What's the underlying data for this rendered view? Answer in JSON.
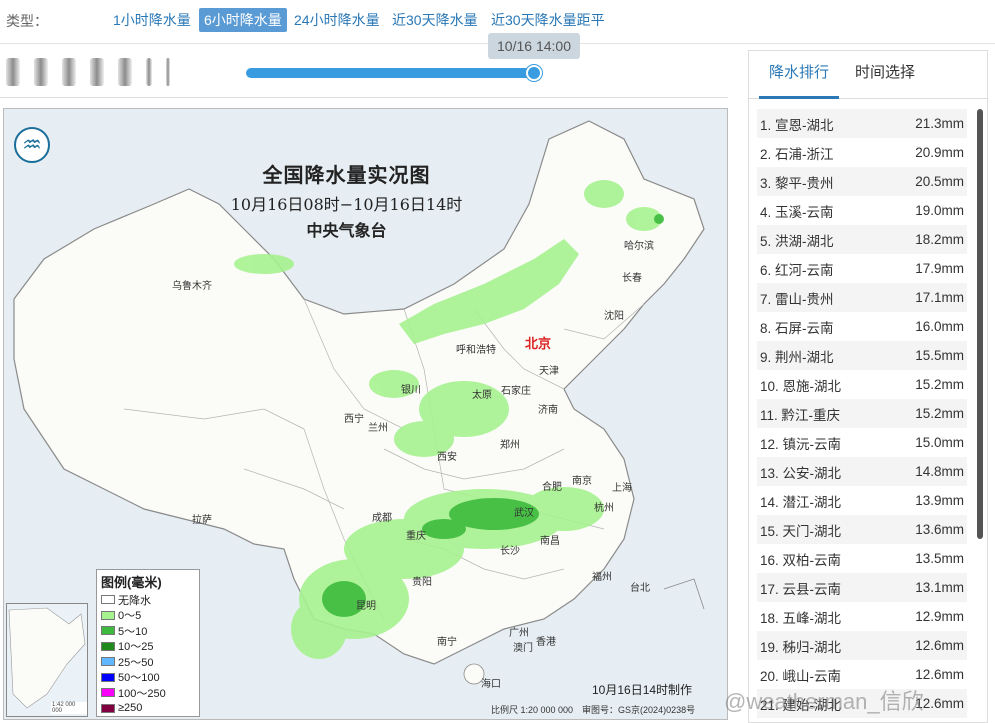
{
  "type_bar": {
    "label": "类型：",
    "tabs": [
      {
        "label": "1小时降水量",
        "active": false
      },
      {
        "label": "6小时降水量",
        "active": true
      },
      {
        "label": "24小时降水量",
        "active": false
      },
      {
        "label": "近30天降水量",
        "active": false
      },
      {
        "label": "近30天降水量距平",
        "active": false
      }
    ]
  },
  "timeline": {
    "current_time": "10/16 14:00",
    "progress_fraction": 1.0
  },
  "map": {
    "title": "全国降水量实况图",
    "time_range": "10月16日08时−10月16日14时",
    "issuer": "中央气象台",
    "made_time": "10月16日14时制作",
    "footer": "比例尺 1:20 000 000　审图号：GS京(2024)0238号",
    "inset_scale": "1:42 000 000",
    "legend": {
      "title": "图例(毫米)",
      "items": [
        {
          "label": "无降水",
          "color": "#ffffff"
        },
        {
          "label": "0～5",
          "color": "#a6f28f"
        },
        {
          "label": "5～10",
          "color": "#3dba3d"
        },
        {
          "label": "10～25",
          "color": "#1e8a1e"
        },
        {
          "label": "25～50",
          "color": "#61b8ff"
        },
        {
          "label": "50～100",
          "color": "#0000fe"
        },
        {
          "label": "100～250",
          "color": "#fa00fa"
        },
        {
          "label": "≥250",
          "color": "#800040"
        }
      ]
    },
    "cities": {
      "urumqi": "乌鲁木齐",
      "harbin": "哈尔滨",
      "changchun": "长春",
      "shenyang": "沈阳",
      "hohhot": "呼和浩特",
      "beijing": "北京",
      "tianjin": "天津",
      "shijiazhuang": "石家庄",
      "taiyuan": "太原",
      "yinchuan": "银川",
      "xining": "西宁",
      "lanzhou": "兰州",
      "jinan": "济南",
      "zhengzhou": "郑州",
      "xian": "西安",
      "hefei": "合肥",
      "nanjing": "南京",
      "shanghai": "上海",
      "hangzhou": "杭州",
      "wuhan": "武汉",
      "chengdu": "成都",
      "chongqing": "重庆",
      "lhasa": "拉萨",
      "nanchang": "南昌",
      "changsha": "长沙",
      "fuzhou": "福州",
      "taipei": "台北",
      "guiyang": "贵阳",
      "kunming": "昆明",
      "nanning": "南宁",
      "guangzhou": "广州",
      "hongkong": "香港",
      "macau": "澳门",
      "haikou": "海口"
    }
  },
  "rank_panel": {
    "tabs": [
      {
        "label": "降水排行",
        "active": true
      },
      {
        "label": "时间选择",
        "active": false
      }
    ],
    "rows": [
      {
        "station": "1. 宣恩-湖北",
        "value": "21.3mm"
      },
      {
        "station": "2. 石浦-浙江",
        "value": "20.9mm"
      },
      {
        "station": "3. 黎平-贵州",
        "value": "20.5mm"
      },
      {
        "station": "4. 玉溪-云南",
        "value": "19.0mm"
      },
      {
        "station": "5. 洪湖-湖北",
        "value": "18.2mm"
      },
      {
        "station": "6. 红河-云南",
        "value": "17.9mm"
      },
      {
        "station": "7. 雷山-贵州",
        "value": "17.1mm"
      },
      {
        "station": "8. 石屏-云南",
        "value": "16.0mm"
      },
      {
        "station": "9. 荆州-湖北",
        "value": "15.5mm"
      },
      {
        "station": "10. 恩施-湖北",
        "value": "15.2mm"
      },
      {
        "station": "11. 黔江-重庆",
        "value": "15.2mm"
      },
      {
        "station": "12. 镇沅-云南",
        "value": "15.0mm"
      },
      {
        "station": "13. 公安-湖北",
        "value": "14.8mm"
      },
      {
        "station": "14. 潜江-湖北",
        "value": "13.9mm"
      },
      {
        "station": "15. 天门-湖北",
        "value": "13.6mm"
      },
      {
        "station": "16. 双柏-云南",
        "value": "13.5mm"
      },
      {
        "station": "17. 云县-云南",
        "value": "13.1mm"
      },
      {
        "station": "18. 五峰-湖北",
        "value": "12.9mm"
      },
      {
        "station": "19. 秭归-湖北",
        "value": "12.6mm"
      },
      {
        "station": "20. 峨山-云南",
        "value": "12.6mm"
      },
      {
        "station": "21. 建始-湖北",
        "value": "12.6mm"
      }
    ]
  },
  "watermark": "@weatherman_信欣"
}
